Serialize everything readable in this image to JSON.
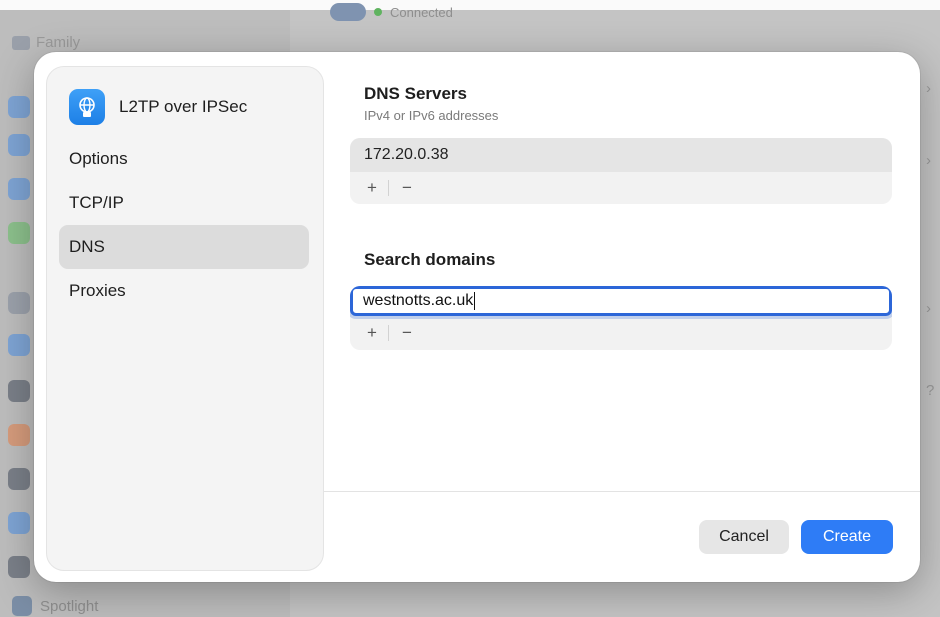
{
  "background": {
    "sidebar_top_label": "Family",
    "status_text": "Connected",
    "sidebar_bottom_label": "Spotlight",
    "right_help": "?"
  },
  "dialog": {
    "sidebar": {
      "title": "L2TP over IPSec",
      "icon": "globe-lock-icon",
      "items": [
        {
          "label": "Options",
          "selected": false
        },
        {
          "label": "TCP/IP",
          "selected": false
        },
        {
          "label": "DNS",
          "selected": true
        },
        {
          "label": "Proxies",
          "selected": false
        }
      ]
    },
    "dns": {
      "title": "DNS Servers",
      "subtitle": "IPv4 or IPv6 addresses",
      "servers": [
        "172.20.0.38"
      ],
      "add": "+",
      "remove": "−"
    },
    "search": {
      "title": "Search domains",
      "domains": [
        "westnotts.ac.uk"
      ],
      "add": "+",
      "remove": "−"
    },
    "buttons": {
      "cancel": "Cancel",
      "create": "Create"
    },
    "colors": {
      "accent": "#2e7cf6",
      "focus_ring": "#2c66d8"
    }
  }
}
